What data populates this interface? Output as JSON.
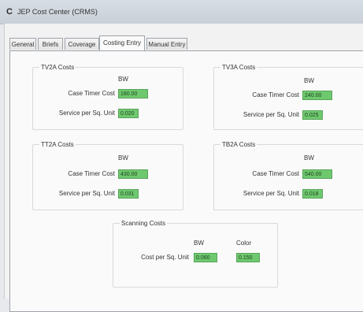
{
  "window": {
    "title": "JEP Cost Center (CRMS)",
    "app_glyph": "C"
  },
  "tabs": [
    "General",
    "Briefs",
    "Coverage",
    "Costing Entry",
    "Manual Entry"
  ],
  "active_tab": "Costing Entry",
  "groups": [
    {
      "title": "TV2A Costs",
      "col_header": "BW",
      "rows": [
        {
          "label": "Case Timer Cost",
          "value": "180.00"
        },
        {
          "label": "Service per Sq. Unit",
          "value": "0.020"
        }
      ]
    },
    {
      "title": "TV3A Costs",
      "col_header": "BW",
      "rows": [
        {
          "label": "Case Timer Cost",
          "value": "240.00"
        },
        {
          "label": "Service per Sq. Unit",
          "value": "0.025"
        }
      ]
    },
    {
      "title": "TT2A Costs",
      "col_header": "BW",
      "rows": [
        {
          "label": "Case Timer Cost",
          "value": "430.00"
        },
        {
          "label": "Service per Sq. Unit",
          "value": "0.031"
        }
      ]
    },
    {
      "title": "TB2A Costs",
      "col_header": "BW",
      "rows": [
        {
          "label": "Case Timer Cost",
          "value": "540.00"
        },
        {
          "label": "Service per Sq. Unit",
          "value": "0.018"
        }
      ]
    }
  ],
  "scanning": {
    "title": "Scanning Costs",
    "col_bw": "BW",
    "col_color": "Color",
    "row_label": "Cost per Sq. Unit",
    "bw_value": "0.060",
    "color_value": "0.150"
  },
  "colors": {
    "field_fill": "#6ec96e",
    "field_border": "#5aa35a"
  }
}
